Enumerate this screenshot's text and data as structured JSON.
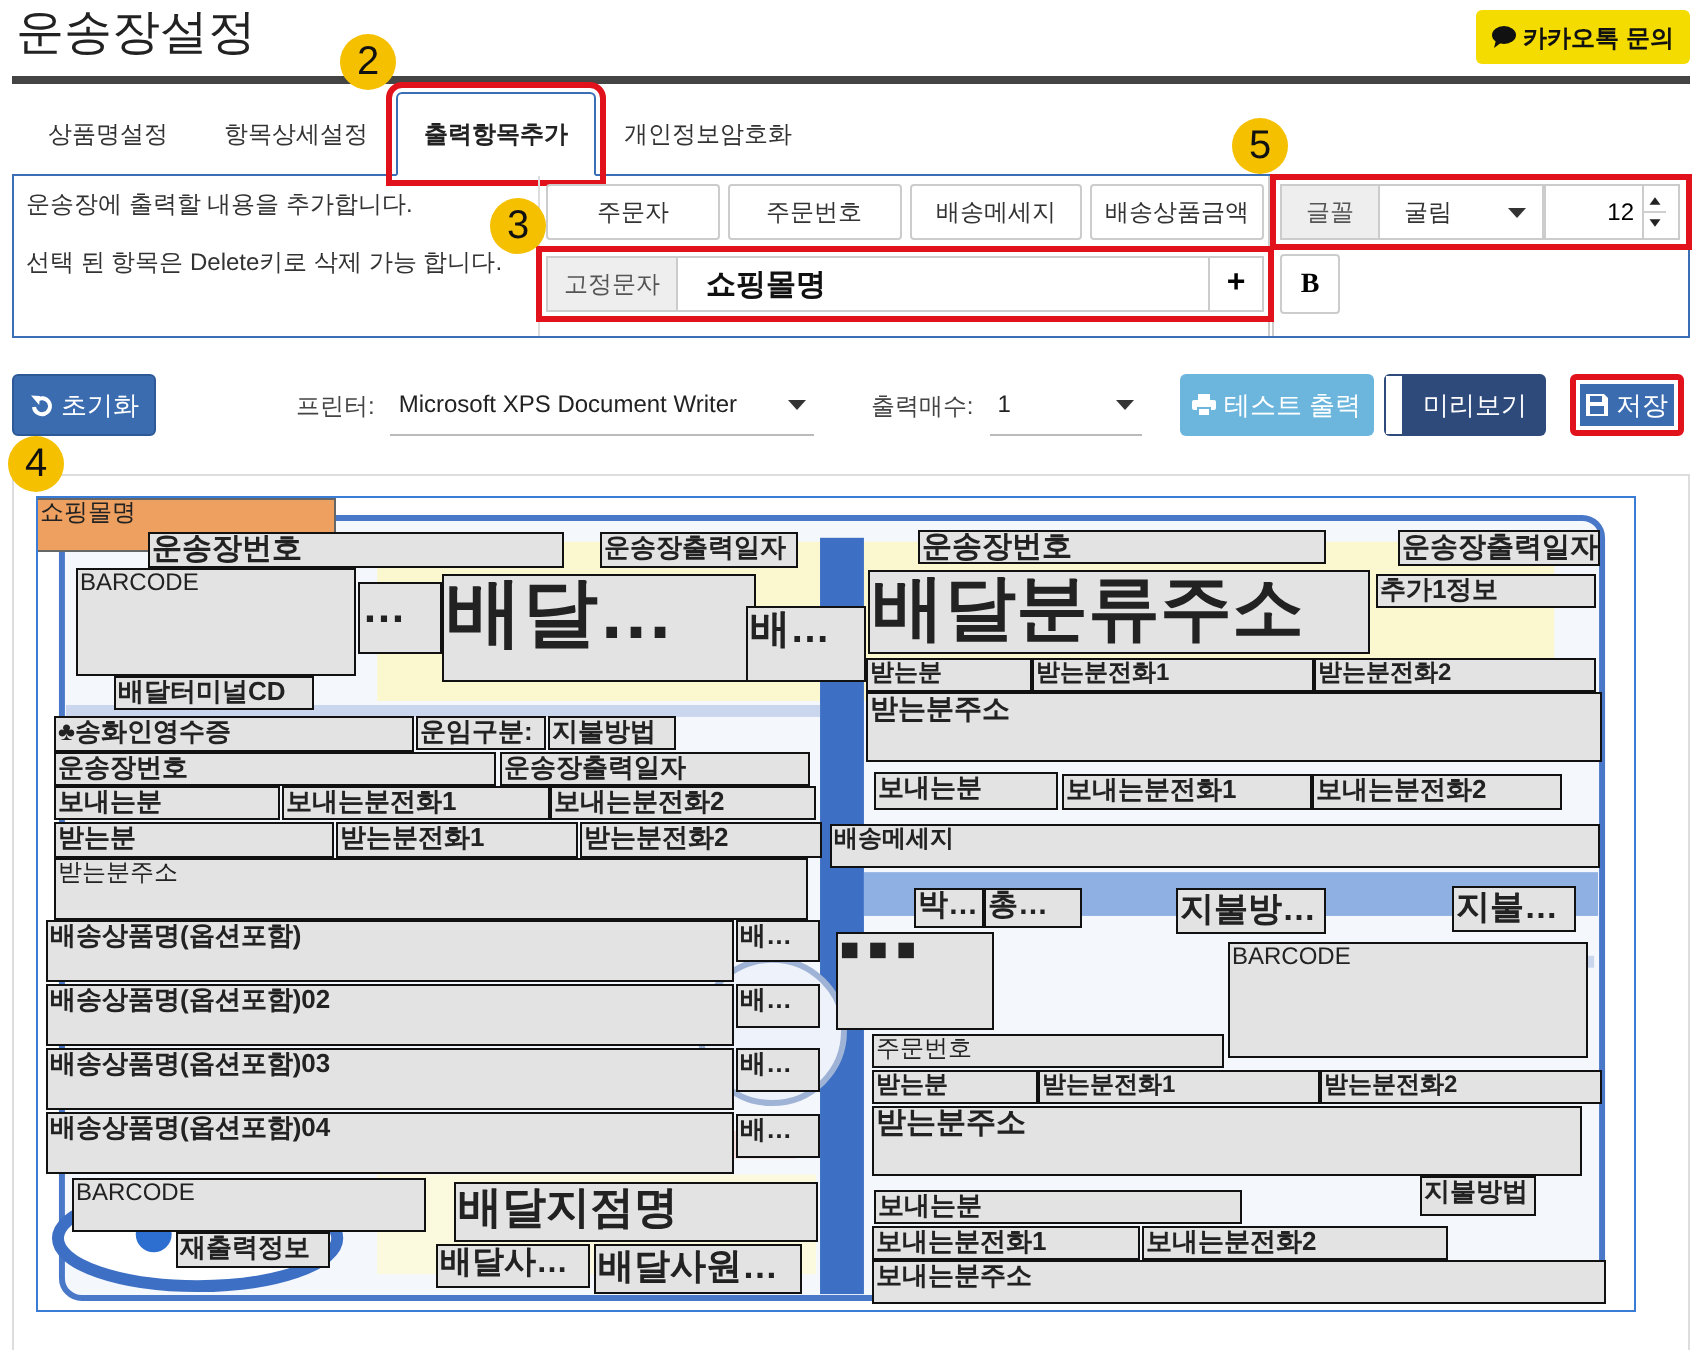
{
  "title": "운송장설정",
  "kakao_button": {
    "label": "카카오톡 문의"
  },
  "callouts": [
    {
      "label": "2"
    },
    {
      "label": "3"
    },
    {
      "label": "4"
    },
    {
      "label": "5"
    }
  ],
  "tabs": [
    {
      "label": "상품명설정",
      "selected": false,
      "highlighted": false
    },
    {
      "label": "항목상세설정",
      "selected": false,
      "highlighted": false
    },
    {
      "label": "출력항목추가",
      "selected": true,
      "highlighted": true
    },
    {
      "label": "개인정보암호화",
      "selected": false,
      "highlighted": false
    }
  ],
  "help_lines": [
    "운송장에 출력할 내용을 추가합니다.",
    "선택 된 항목은 Delete키로 삭제 가능 합니다."
  ],
  "item_buttons": [
    "주문자",
    "주문번호",
    "배송메세지",
    "배송상품금액"
  ],
  "fixed_text": {
    "label": "고정문자",
    "value": "쇼핑몰명",
    "add": "+",
    "highlighted": true
  },
  "font": {
    "label": "글꼴",
    "family": "굴림",
    "size": "12",
    "highlighted": true
  },
  "bold_button": {
    "label": "B",
    "pressed": false
  },
  "reset_button": {
    "label": "초기화"
  },
  "printer": {
    "label": "프린터:",
    "value": "Microsoft XPS Document Writer"
  },
  "copies": {
    "label": "출력매수:",
    "value": "1"
  },
  "test_print_button": {
    "label": "테스트 출력"
  },
  "preview_toggle": {
    "label": "미리보기",
    "on": false
  },
  "save_button": {
    "label": "저장",
    "highlighted": true
  },
  "fields": [
    {
      "text": "쇼핑몰명",
      "selected": true
    },
    {
      "text": "운송장번호",
      "selected": false
    },
    {
      "text": "운송장출력일자",
      "selected": false
    },
    {
      "text": "BARCODE",
      "selected": false
    },
    {
      "text": "…",
      "selected": false
    },
    {
      "text": "배달…",
      "selected": false
    },
    {
      "text": "배…",
      "selected": false
    },
    {
      "text": "배달터미널CD",
      "selected": false
    },
    {
      "text": "운송장번호",
      "selected": false
    },
    {
      "text": "운송장출력일자",
      "selected": false
    },
    {
      "text": "배달분류주소",
      "selected": false
    },
    {
      "text": "추가1정보",
      "selected": false
    },
    {
      "text": "받는분",
      "selected": false
    },
    {
      "text": "받는분전화1",
      "selected": false
    },
    {
      "text": "받는분전화2",
      "selected": false
    },
    {
      "text": "받는분주소",
      "selected": false
    },
    {
      "text": "♣송화인영수증",
      "selected": false
    },
    {
      "text": "운임구분:",
      "selected": false
    },
    {
      "text": "지불방법",
      "selected": false
    },
    {
      "text": "운송장번호",
      "selected": false
    },
    {
      "text": "운송장출력일자",
      "selected": false
    },
    {
      "text": "보내는분",
      "selected": false
    },
    {
      "text": "보내는분전화1",
      "selected": false
    },
    {
      "text": "보내는분전화2",
      "selected": false
    },
    {
      "text": "받는분",
      "selected": false
    },
    {
      "text": "받는분전화1",
      "selected": false
    },
    {
      "text": "받는분전화2",
      "selected": false
    },
    {
      "text": "받는분주소",
      "selected": false
    },
    {
      "text": "보내는분",
      "selected": false
    },
    {
      "text": "보내는분전화1",
      "selected": false
    },
    {
      "text": "보내는분전화2",
      "selected": false
    },
    {
      "text": "배송메세지",
      "selected": false
    },
    {
      "text": "배송상품명(옵션포함)",
      "selected": false
    },
    {
      "text": "배…",
      "selected": false
    },
    {
      "text": "배송상품명(옵션포함)02",
      "selected": false
    },
    {
      "text": "배…",
      "selected": false
    },
    {
      "text": "배송상품명(옵션포함)03",
      "selected": false
    },
    {
      "text": "배…",
      "selected": false
    },
    {
      "text": "배송상품명(옵션포함)04",
      "selected": false
    },
    {
      "text": "배…",
      "selected": false
    },
    {
      "text": "BARCODE",
      "selected": false
    },
    {
      "text": "재출력정보",
      "selected": false
    },
    {
      "text": "배달지점명",
      "selected": false
    },
    {
      "text": "배달사…",
      "selected": false
    },
    {
      "text": "배달사원…",
      "selected": false
    },
    {
      "text": "박…",
      "selected": false
    },
    {
      "text": "총…",
      "selected": false
    },
    {
      "text": "지불방…",
      "selected": false
    },
    {
      "text": "지불…",
      "selected": false
    },
    {
      "text": "■ ■ ■",
      "selected": false
    },
    {
      "text": "BARCODE",
      "selected": false
    },
    {
      "text": "주문번호",
      "selected": false
    },
    {
      "text": "받는분",
      "selected": false
    },
    {
      "text": "받는분전화1",
      "selected": false
    },
    {
      "text": "받는분전화2",
      "selected": false
    },
    {
      "text": "받는분주소",
      "selected": false
    },
    {
      "text": "지불방법",
      "selected": false
    },
    {
      "text": "보내는분",
      "selected": false
    },
    {
      "text": "보내는분전화1",
      "selected": false
    },
    {
      "text": "보내는분전화2",
      "selected": false
    },
    {
      "text": "보내는분주소",
      "selected": false
    }
  ]
}
